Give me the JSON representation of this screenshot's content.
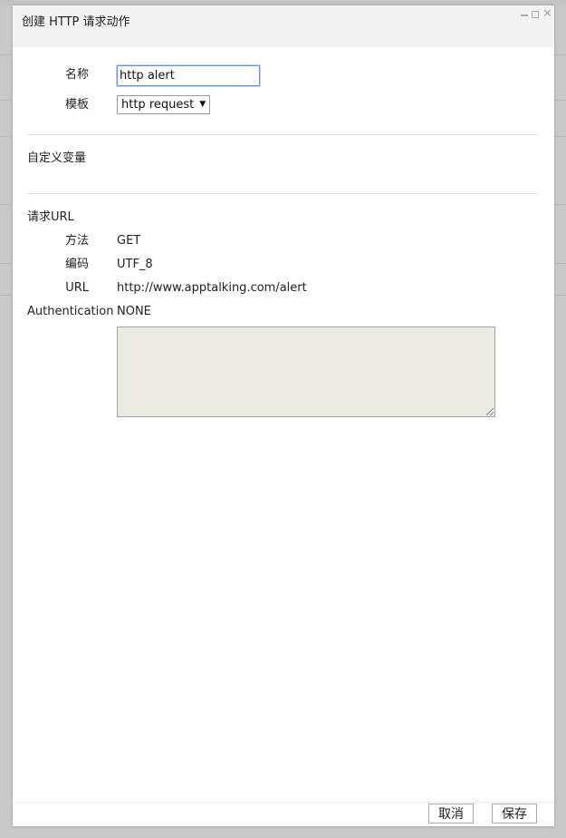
{
  "dialog": {
    "title": "创建 HTTP 请求动作",
    "controls": {
      "minimize": "minimize-icon",
      "maximize": "maximize-icon",
      "close": "close-icon"
    }
  },
  "form": {
    "name_label": "名称",
    "name_value": "http alert",
    "template_label": "模板",
    "template_value": "http request",
    "custom_vars_label": "自定义变量",
    "request_url_label": "请求URL",
    "method_label": "方法",
    "method_value": "GET",
    "encoding_label": "编码",
    "encoding_value": "UTF_8",
    "url_label": "URL",
    "url_value": "http://www.apptalking.com/alert",
    "auth_label": "Authentication",
    "auth_value": "NONE",
    "body_text": ""
  },
  "footer": {
    "cancel_label": "取消",
    "save_label": "保存"
  },
  "colors": {
    "title_bg": "#f3f3f3",
    "input_focus_border": "#5b95d6",
    "textarea_bg": "#ebeae3",
    "backdrop": "#c9c9c9"
  }
}
